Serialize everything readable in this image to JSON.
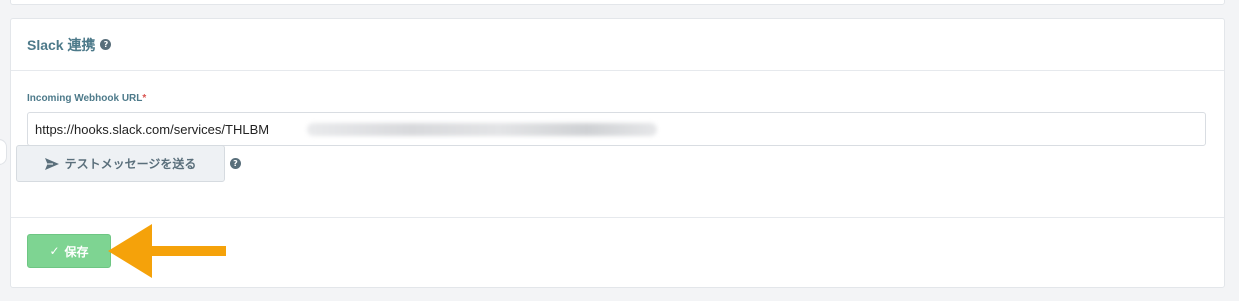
{
  "card": {
    "title": "Slack 連携",
    "title_help_icon": "question-circle-icon"
  },
  "webhook": {
    "label": "Incoming Webhook URL",
    "required_mark": "*",
    "value": "https://hooks.slack.com/services/THLBM"
  },
  "test_button": {
    "icon": "paper-plane-icon",
    "label": "テストメッセージを送る",
    "help_icon": "question-circle-icon"
  },
  "save_button": {
    "icon": "check-icon",
    "label": "保存"
  },
  "annotation": {
    "arrow_color": "#f5a20a"
  },
  "colors": {
    "accent": "#4d7a8a",
    "save_green": "#7ed492",
    "required_red": "#d9534f"
  }
}
